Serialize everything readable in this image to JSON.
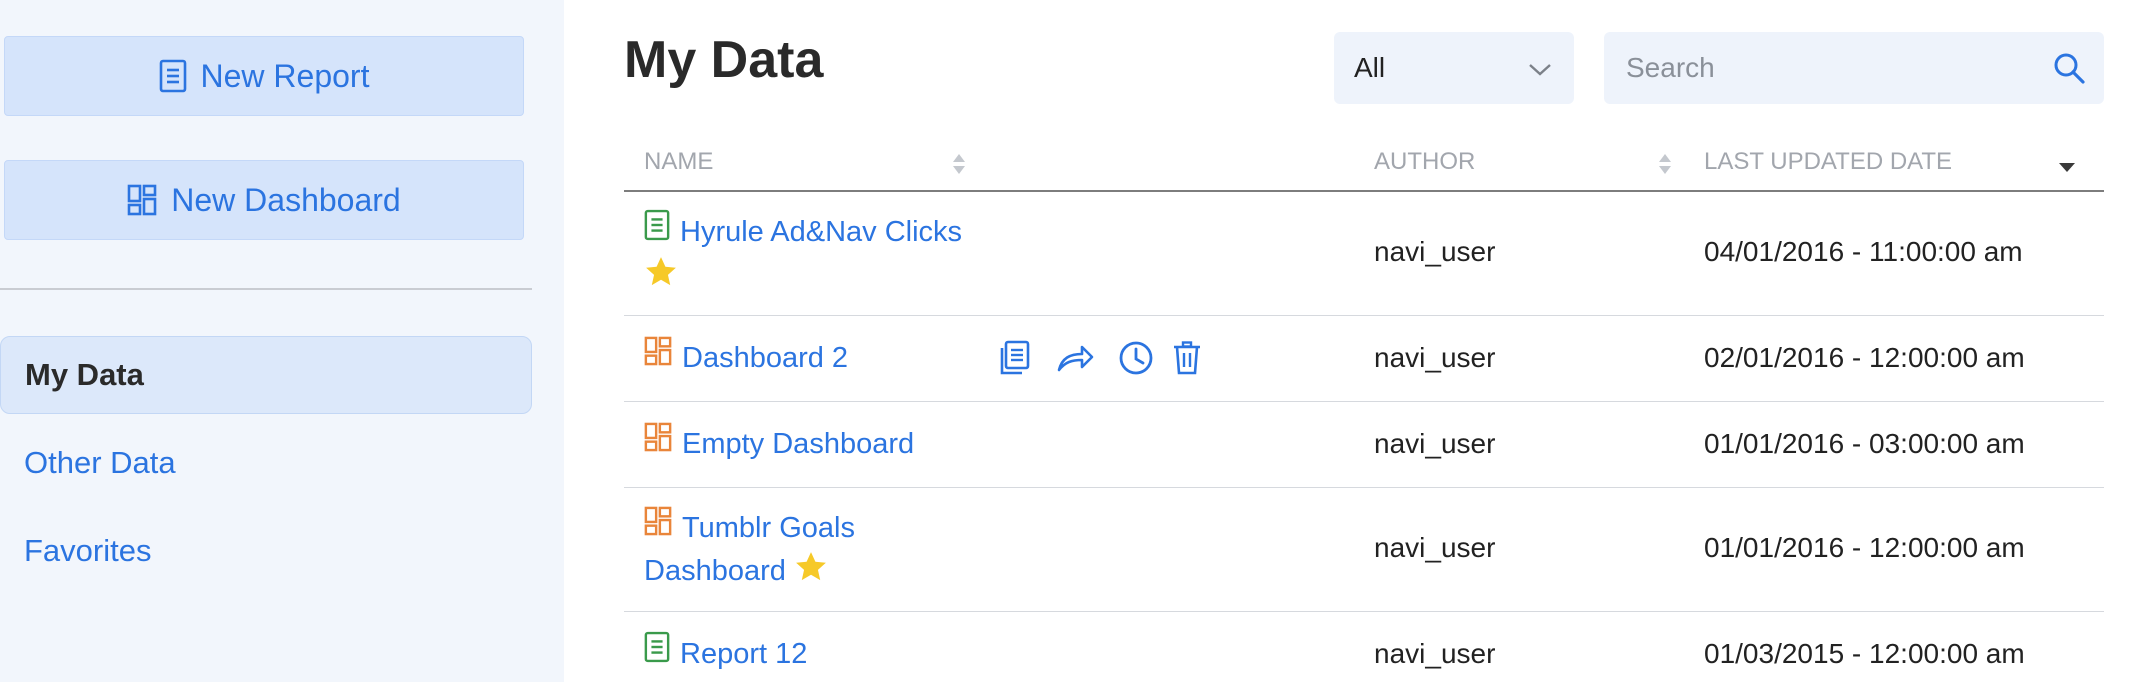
{
  "sidebar": {
    "new_report_label": "New Report",
    "new_dashboard_label": "New Dashboard",
    "nav": [
      {
        "label": "My Data",
        "active": true
      },
      {
        "label": "Other Data",
        "active": false
      },
      {
        "label": "Favorites",
        "active": false
      }
    ]
  },
  "header": {
    "title": "My Data",
    "filter_value": "All",
    "search_placeholder": "Search"
  },
  "table": {
    "columns": [
      "NAME",
      "AUTHOR",
      "LAST UPDATED DATE"
    ],
    "rows": [
      {
        "name_line1": "Hyrule Ad&Nav Clicks",
        "name_line2": "",
        "type": "report",
        "favorite": true,
        "author": "navi_user",
        "date": "04/01/2016 - 11:00:00 am"
      },
      {
        "name_line1": "Dashboard 2",
        "name_line2": "",
        "type": "dashboard",
        "favorite": false,
        "author": "navi_user",
        "date": "02/01/2016 - 12:00:00 am"
      },
      {
        "name_line1": "Empty Dashboard",
        "name_line2": "",
        "type": "dashboard",
        "favorite": false,
        "author": "navi_user",
        "date": "01/01/2016 - 03:00:00 am"
      },
      {
        "name_line1": "Tumblr Goals",
        "name_line2": "Dashboard",
        "type": "dashboard",
        "favorite": true,
        "author": "navi_user",
        "date": "01/01/2016 - 12:00:00 am"
      },
      {
        "name_line1": "Report 12",
        "name_line2": "",
        "type": "report",
        "favorite": false,
        "author": "navi_user",
        "date": "01/03/2015 - 12:00:00 am"
      }
    ]
  },
  "colors": {
    "accent": "#2b74e0",
    "report_icon": "#3a9a4b",
    "dashboard_icon": "#e9853a",
    "star": "#f6c928"
  },
  "icons": {
    "report": "report-icon",
    "dashboard": "dashboard-icon",
    "search": "search-icon",
    "filter_chevron": "chevron-down-icon",
    "row_actions": [
      "clone-icon",
      "share-icon",
      "schedule-icon",
      "delete-icon"
    ]
  }
}
